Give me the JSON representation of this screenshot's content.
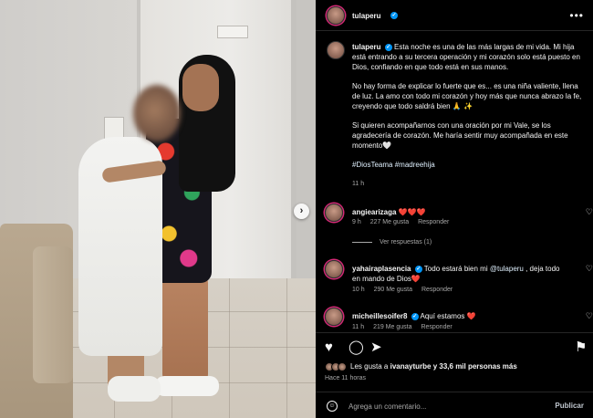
{
  "post": {
    "username": "tulaperu",
    "caption": [
      "Esta noche es una de las más largas de mi vida. Mi hija está entrando a su tercera operación y mi corazón solo está puesto en Dios, confiando en que todo está en sus manos.",
      "No hay forma de explicar lo fuerte que es... es una niña valiente, llena de luz. La amo con todo mi corazón y hoy más que nunca abrazo la fe, creyendo que todo saldrá bien 🙏 ✨",
      "Si quieren acompañarnos con una oración por mi Vale, se los agradecería de corazón. Me haría sentir muy acompañada en este momento🤍"
    ],
    "hashtags": [
      "#DiosTeama",
      "#madreehija"
    ],
    "time": "11 h"
  },
  "comments": [
    {
      "username": "angiearizaga",
      "text": "❤️❤️❤️",
      "time": "9 h",
      "likes": "227 Me gusta",
      "reply": "Responder",
      "view_replies": "Ver respuestas (1)"
    },
    {
      "username": "yahairaplasencia",
      "text_pre": "Todo estará bien mi ",
      "mention": "@tulaperu",
      "text_post": " , deja todo en mando de Dios❤️",
      "time": "10 h",
      "likes": "290 Me gusta",
      "reply": "Responder"
    },
    {
      "username": "micheillesoifer8",
      "text": "Aquí estamos ❤️",
      "time": "11 h",
      "likes": "219 Me gusta",
      "reply": "Responder"
    }
  ],
  "footer": {
    "likes_pre": "Les gusta a ",
    "likes_user": "ivanayturbe",
    "likes_post": " y 33,6 mil personas más",
    "time_ago": "Hace 11 horas",
    "comment_placeholder": "Agrega un comentario...",
    "publish_label": "Publicar"
  },
  "icons": {
    "more": "•••",
    "next": "›",
    "heart_filled": "♥",
    "heart_outline": "♡",
    "comment": "◯",
    "share": "➤",
    "save": "⚑",
    "emoji": "☺",
    "verified": "✓"
  },
  "colors": {
    "background": "#000000",
    "like_red": "#ff3040",
    "verified_blue": "#0095f6",
    "link": "#e0f1ff",
    "muted": "#a8a8a8"
  }
}
